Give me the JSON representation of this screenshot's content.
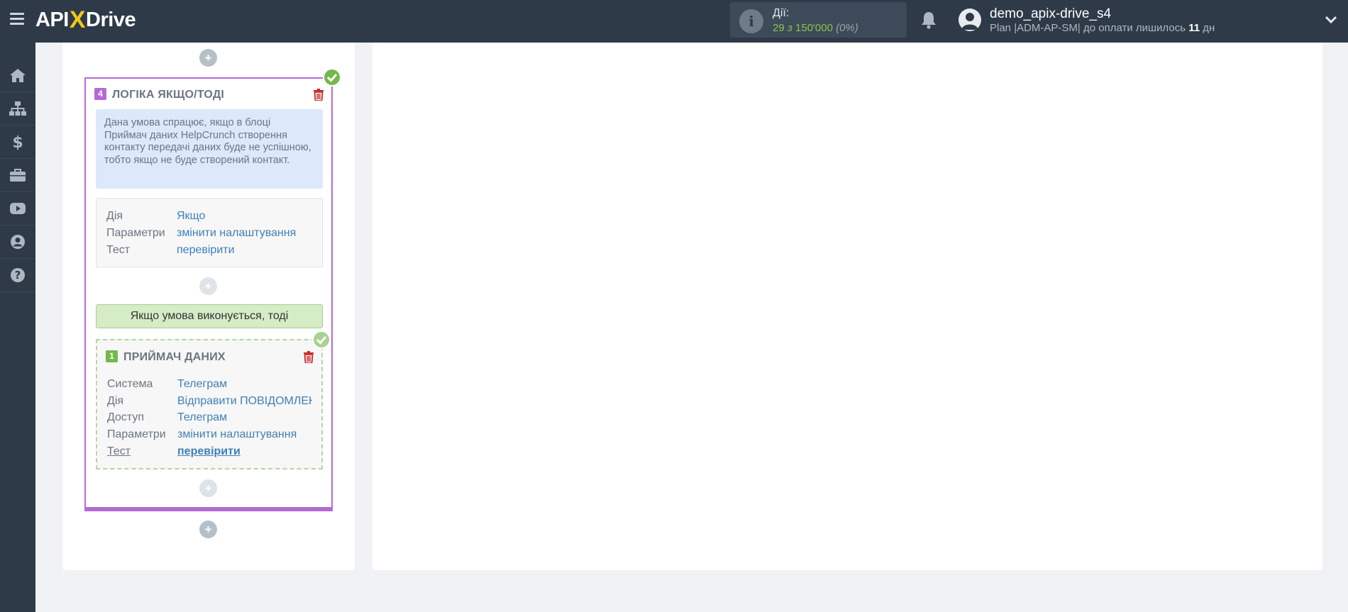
{
  "header": {
    "logo_prefix": "API",
    "logo_x": "X",
    "logo_suffix": "Drive",
    "actions_label": "Дії:",
    "actions_used": "29",
    "actions_of": "з",
    "actions_total": "150'000",
    "actions_pct": "(0%)",
    "user_name": "demo_apix-drive_s4",
    "plan_prefix": "Plan |ADM-AP-SM| до оплати лишилось ",
    "plan_days": "11",
    "plan_suffix": " дн"
  },
  "sidebar": {
    "items": [
      {
        "name": "home-icon"
      },
      {
        "name": "sitemap-icon"
      },
      {
        "name": "dollar-icon"
      },
      {
        "name": "briefcase-icon"
      },
      {
        "name": "youtube-icon"
      },
      {
        "name": "user-icon"
      },
      {
        "name": "help-icon"
      }
    ]
  },
  "logic_block": {
    "number": "4",
    "title": "ЛОГІКА ЯКЩО/ТОДІ",
    "note": "Дана умова спрацює, якщо в блоці Приймач даних HelpCrunch створення контакту передачі даних буде не успішною, тобто якщо не буде створений контакт.",
    "rows": [
      {
        "label": "Дія",
        "value": "Якщо"
      },
      {
        "label": "Параметри",
        "value": "змінити налаштування"
      },
      {
        "label": "Тест",
        "value": "перевірити"
      }
    ],
    "condition_label": "Якщо умова виконується, тоді"
  },
  "receiver_block": {
    "number": "1",
    "title": "ПРИЙМАЧ ДАНИХ",
    "rows": [
      {
        "label": "Система",
        "value": "Телеграм"
      },
      {
        "label": "Дія",
        "value": "Відправити ПОВІДОМЛЕННЯ"
      },
      {
        "label": "Доступ",
        "value": "Телеграм"
      },
      {
        "label": "Параметри",
        "value": "змінити налаштування"
      },
      {
        "label": "Тест",
        "value": "перевірити"
      }
    ]
  },
  "plus_label": "+",
  "colors": {
    "topbar": "#2e3a48",
    "logic_accent": "#b569d6",
    "receiver_accent": "#72b84a",
    "link": "#3f7fb8"
  }
}
